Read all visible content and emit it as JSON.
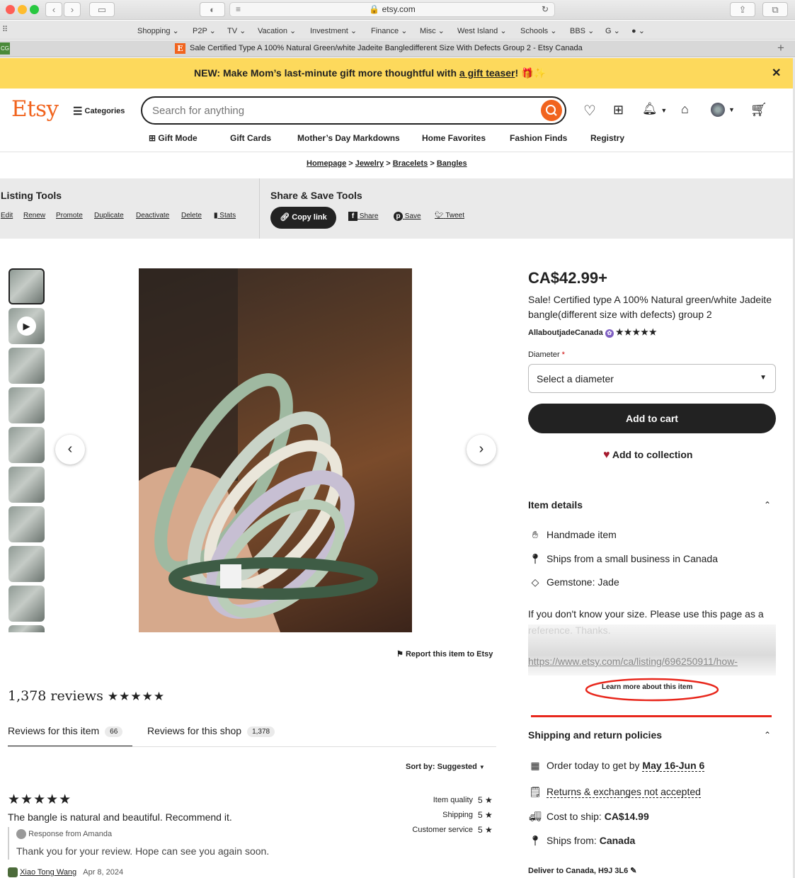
{
  "browser": {
    "url": "etsy.com",
    "tab_title": "Sale Certified Type A 100% Natural Green/white Jadeite Bangledifferent Size With Defects Group 2 - Etsy Canada",
    "bookmarks": [
      "Shopping",
      "P2P",
      "TV",
      "Vacation",
      "Investment",
      "Finance",
      "Misc",
      "West Island",
      "Schools",
      "BBS",
      "G",
      ""
    ]
  },
  "promo": {
    "prefix": "NEW: Make Mom’s last-minute gift more thoughtful with ",
    "link": "a gift teaser",
    "suffix": "!"
  },
  "header": {
    "logo": "Etsy",
    "categories": "Categories",
    "search_placeholder": "Search for anything",
    "nav": [
      "Gift Mode",
      "Gift Cards",
      "Mother’s Day Markdowns",
      "Home Favorites",
      "Fashion Finds",
      "Registry"
    ]
  },
  "breadcrumb": [
    "Homepage",
    "Jewelry",
    "Bracelets",
    "Bangles"
  ],
  "listing_tools": {
    "title": "Listing Tools",
    "links": [
      "Edit",
      "Renew",
      "Promote",
      "Duplicate",
      "Deactivate",
      "Delete",
      "Stats"
    ]
  },
  "share_tools": {
    "title": "Share & Save Tools",
    "copy_link": "Copy link",
    "links": [
      "Share",
      "Save",
      "Tweet"
    ]
  },
  "report": "Report this item to Etsy",
  "product": {
    "price": "CA$42.99+",
    "title": "Sale! Certified type A 100% Natural green/white Jadeite bangle(different size with defects) group 2",
    "shop": "AllaboutjadeCanada",
    "rating_stars": "★★★★★",
    "diameter_label": "Diameter",
    "diameter_select": "Select a diameter",
    "add_to_cart": "Add to cart",
    "add_to_collection": "Add to collection"
  },
  "item_details": {
    "heading": "Item details",
    "items": [
      "Handmade item",
      "Ships from a small business in Canada",
      "Gemstone: Jade"
    ],
    "description": "If you don't know your size. Please use this page as a reference. Thanks.",
    "link_text": "https://www.etsy.com/ca/listing/696250911/how-",
    "learn_more": "Learn more about this item"
  },
  "shipping": {
    "heading": "Shipping and return policies",
    "order_prefix": "Order today to get by ",
    "order_dates": "May 16-Jun 6",
    "returns": "Returns & exchanges not accepted",
    "cost_label": "Cost to ship: ",
    "cost_value": "CA$14.99",
    "ships_label": "Ships from: ",
    "ships_value": "Canada",
    "deliver_to": "Deliver to Canada, H9J 3L6"
  },
  "reviews": {
    "count_text": "1,378 reviews",
    "stars": "★★★★★",
    "tab_item": "Reviews for this item",
    "tab_item_count": "66",
    "tab_shop": "Reviews for this shop",
    "tab_shop_count": "1,378",
    "sort": "Sort by: Suggested",
    "review_stars": "★★★★★",
    "review_text": "The bangle is natural and beautiful. Recommend it.",
    "response_from": "Response from Amanda",
    "response_text": "Thank you for your review. Hope can see you again soon.",
    "reviewer": "Xiao Tong Wang",
    "date": "Apr 8, 2024",
    "ratings": [
      {
        "label": "Item quality",
        "value": "5"
      },
      {
        "label": "Shipping",
        "value": "5"
      },
      {
        "label": "Customer service",
        "value": "5"
      }
    ]
  },
  "colors": {
    "accent": "#f1641e",
    "promo": "#fdd95c",
    "annotation": "#e8271c"
  }
}
